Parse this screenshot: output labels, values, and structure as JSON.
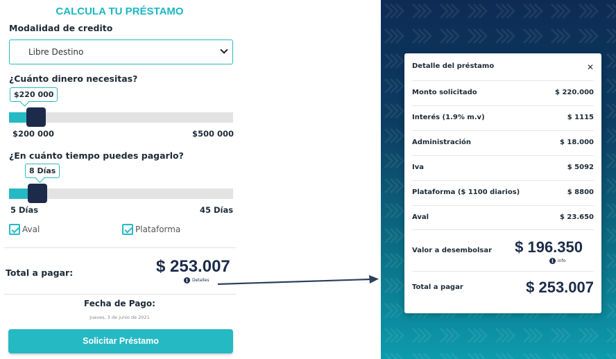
{
  "calculator": {
    "title": "CALCULA TU PRÉSTAMO",
    "modalidad_label": "Modalidad de credito",
    "modalidad_value": "Libre Destino",
    "amount_question": "¿Cuánto dinero necesitas?",
    "amount_value": "$220 000",
    "amount_min": "$200 000",
    "amount_max": "$500 000",
    "amount_fraction": 0.067,
    "term_question": "¿En cuánto tiempo puedes pagarlo?",
    "term_value": "8 Días",
    "term_min": "5 Días",
    "term_max": "45 Días",
    "term_fraction": 0.075,
    "checkboxes": [
      {
        "label": "Aval",
        "checked": true
      },
      {
        "label": "Plataforma",
        "checked": true
      }
    ],
    "total_label": "Total a pagar:",
    "total_value": "$ 253.007",
    "details_link": "Detalles",
    "fecha_label": "Fecha de Pago:",
    "fecha_value": "Jueves, 3 de junio de 2021",
    "submit_label": "Solicitar Préstamo"
  },
  "detail_modal": {
    "title": "Detalle del préstamo",
    "close_icon": "close-icon",
    "rows": [
      {
        "label": "Monto solicitado",
        "value": "$ 220.000"
      },
      {
        "label": "Interés (1.9% m.v)",
        "value": "$ 1115"
      },
      {
        "label": "Administración",
        "value": "$ 18.000"
      },
      {
        "label": "Iva",
        "value": "$ 5092"
      },
      {
        "label": "Plataforma ($ 1100 diarios)",
        "value": "$ 8800"
      },
      {
        "label": "Aval",
        "value": "$ 23.650"
      }
    ],
    "disburse_label": "Valor a desembolsar",
    "disburse_value": "$ 196.350",
    "info_label": "info",
    "total_label": "Total a pagar",
    "total_value": "$ 253.007"
  },
  "colors": {
    "accent": "#25b9c4",
    "navy": "#1c2b4a"
  }
}
